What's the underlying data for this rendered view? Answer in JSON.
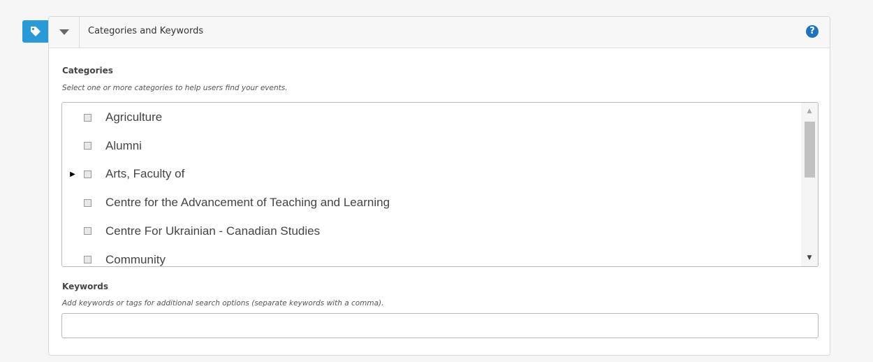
{
  "panel": {
    "title": "Categories and Keywords",
    "help_icon": "question-circle-icon",
    "tag_icon": "tag-icon",
    "toggle_icon": "caret-down-icon",
    "accent_color": "#2a9ad6"
  },
  "categories": {
    "label": "Categories",
    "help": "Select one or more categories to help users find your events.",
    "items": [
      {
        "label": "Agriculture",
        "expandable": false,
        "checked": false
      },
      {
        "label": "Alumni",
        "expandable": false,
        "checked": false
      },
      {
        "label": "Arts, Faculty of",
        "expandable": true,
        "checked": false
      },
      {
        "label": "Centre for the Advancement of Teaching and Learning",
        "expandable": false,
        "checked": false
      },
      {
        "label": "Centre For Ukrainian - Canadian Studies",
        "expandable": false,
        "checked": false
      },
      {
        "label": "Community",
        "expandable": false,
        "checked": false
      }
    ]
  },
  "keywords": {
    "label": "Keywords",
    "help": "Add keywords or tags for additional search options (separate keywords with a comma).",
    "value": ""
  }
}
